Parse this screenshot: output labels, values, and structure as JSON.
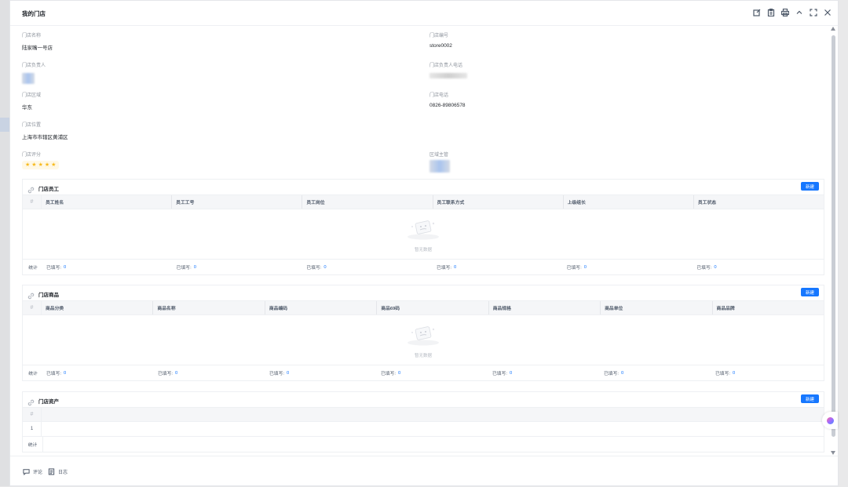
{
  "window": {
    "title": "我的门店"
  },
  "icons": {
    "toolbar": [
      "edit-icon",
      "clipboard-icon",
      "print-icon",
      "collapse-icon",
      "fullscreen-icon",
      "close-icon"
    ],
    "section": "link-icon",
    "footer": [
      "comment-icon",
      "log-icon"
    ]
  },
  "fields": {
    "store_name": {
      "label": "门店名称",
      "value": "陆家嘴一号店"
    },
    "store_code": {
      "label": "门店编号",
      "value": "store0002"
    },
    "manager": {
      "label": "门店负责人"
    },
    "manager_phone": {
      "label": "门店负责人电话"
    },
    "region": {
      "label": "门店区域",
      "value": "华东"
    },
    "phone": {
      "label": "门店电话",
      "value": "0826-89806578"
    },
    "location": {
      "label": "门店位置",
      "value": "上海市市辖区黄浦区"
    },
    "rating": {
      "label": "门店评分",
      "stars": 5
    },
    "assistant": {
      "label": "区域主管"
    }
  },
  "employees": {
    "title": "门店员工",
    "new_label": "新建",
    "hash": "#",
    "columns": [
      "员工姓名",
      "员工工号",
      "员工岗位",
      "员工联系方式",
      "上级组长",
      "员工状态"
    ],
    "empty_text": "暂无数据",
    "stat_label": "统计",
    "stats": [
      {
        "label": "已填写:",
        "count": "0"
      },
      {
        "label": "已填写:",
        "count": "0"
      },
      {
        "label": "已填写:",
        "count": "0"
      },
      {
        "label": "已填写:",
        "count": "0"
      },
      {
        "label": "已填写:",
        "count": "0"
      },
      {
        "label": "已填写:",
        "count": "0"
      }
    ]
  },
  "products": {
    "title": "门店商品",
    "new_label": "新建",
    "hash": "#",
    "columns": [
      "商品分类",
      "商品名称",
      "商品编码",
      "商品69码",
      "商品规格",
      "商品单位",
      "商品品牌"
    ],
    "empty_text": "暂无数据",
    "stat_label": "统计",
    "stats": [
      {
        "label": "已填写:",
        "count": "0"
      },
      {
        "label": "已填写:",
        "count": "0"
      },
      {
        "label": "已填写:",
        "count": "0"
      },
      {
        "label": "已填写:",
        "count": "0"
      },
      {
        "label": "已填写:",
        "count": "0"
      },
      {
        "label": "已填写:",
        "count": "0"
      },
      {
        "label": "已填写:",
        "count": "0"
      }
    ]
  },
  "assets": {
    "title": "门店资产",
    "new_label": "新建",
    "hash": "#",
    "row_num": "1",
    "stat_label": "统计"
  },
  "footer": {
    "comment": "评论",
    "log": "日志"
  },
  "colors": {
    "primary": "#1677ff",
    "star": "#f7ba1e"
  }
}
